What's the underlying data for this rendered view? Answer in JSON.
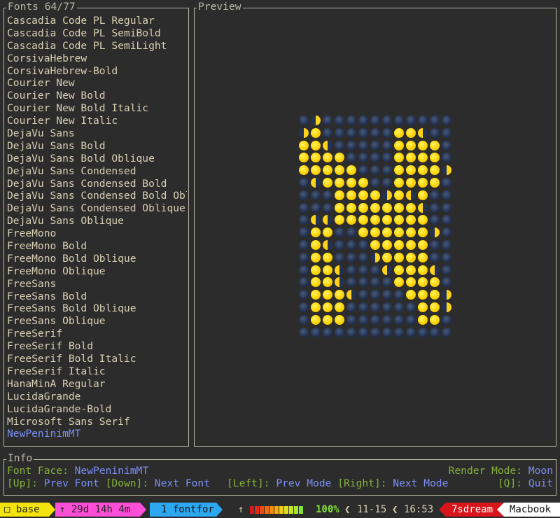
{
  "fonts_panel": {
    "title": "Fonts 64/77",
    "items": [
      "Cascadia Code PL Regular",
      "Cascadia Code PL SemiBold",
      "Cascadia Code PL SemiLight",
      "CorsivaHebrew",
      "CorsivaHebrew-Bold",
      "Courier New",
      "Courier New Bold",
      "Courier New Bold Italic",
      "Courier New Italic",
      "DejaVu Sans",
      "DejaVu Sans Bold",
      "DejaVu Sans Bold Oblique",
      "DejaVu Sans Condensed",
      "DejaVu Sans Condensed Bold",
      "DejaVu Sans Condensed Bold Obl",
      "DejaVu Sans Condensed Oblique",
      "DejaVu Sans Oblique",
      "FreeMono",
      "FreeMono Bold",
      "FreeMono Bold Oblique",
      "FreeMono Oblique",
      "FreeSans",
      "FreeSans Bold",
      "FreeSans Bold Oblique",
      "FreeSans Oblique",
      "FreeSerif",
      "FreeSerif Bold",
      "FreeSerif Bold Italic",
      "FreeSerif Italic",
      "HanaMinA Regular",
      "LucidaGrande",
      "LucidaGrande-Bold",
      "Microsoft Sans Serif",
      "NewPeninimMT"
    ],
    "selected_index": 33
  },
  "preview_panel": {
    "title": "Preview",
    "moon_grid": [
      "n w n n n n n n n n n n n",
      "w f n n n n n n f f e n n",
      "f f e n n n n n f f f f n",
      "f f f f n n n n f f f f n",
      "f f f f f n n n f f f f w",
      "n e f f f f n n f f f f n",
      "n n n f f f f w f e f n n",
      "n n n f f f f f f f e n n",
      "n e e f f f f f f f f n n",
      "n f f n n f f f f f f w n",
      "n f e n n n f f f f f n n",
      "n f f n n n w f f f f n n",
      "n f f e n n n e f f f e n",
      "n f f e n n n n f f f f n",
      "n f f f e n n n n f f f w",
      "n f f f n n n n n n f f w",
      "n f f f n n n n n n f f n",
      "n n n n n n n n n n n n n"
    ]
  },
  "info_panel": {
    "title": "Info",
    "font_face_label": "Font Face:",
    "font_face_value": "NewPeninimMT",
    "render_mode_label": "Render Mode:",
    "render_mode_value": "Moon",
    "key_up": "[Up]:",
    "action_up": "Prev Font",
    "key_down": "[Down]:",
    "action_down": "Next Font",
    "key_left": "[Left]:",
    "action_left": "Prev Mode",
    "key_right": "[Right]:",
    "action_right": "Next Mode",
    "key_q": "[Q]:",
    "action_q": "Quit"
  },
  "status_bar": {
    "session": "□ base",
    "uptime": "↑ 29d 14h 4m",
    "window": "1 fontfor",
    "battery_arrow": "↑",
    "battery_percent": "100%",
    "date": "11-15",
    "time": "16:53",
    "user": "7sdream",
    "host": "Macbook",
    "colors": {
      "session_bg": "#f5e40c",
      "uptime_bg": "#ff4fd8",
      "window_bg": "#2ba8f0",
      "user_bg": "#d8151a",
      "host_bg": "#ffffff",
      "battery_green": "#84e03a"
    }
  }
}
